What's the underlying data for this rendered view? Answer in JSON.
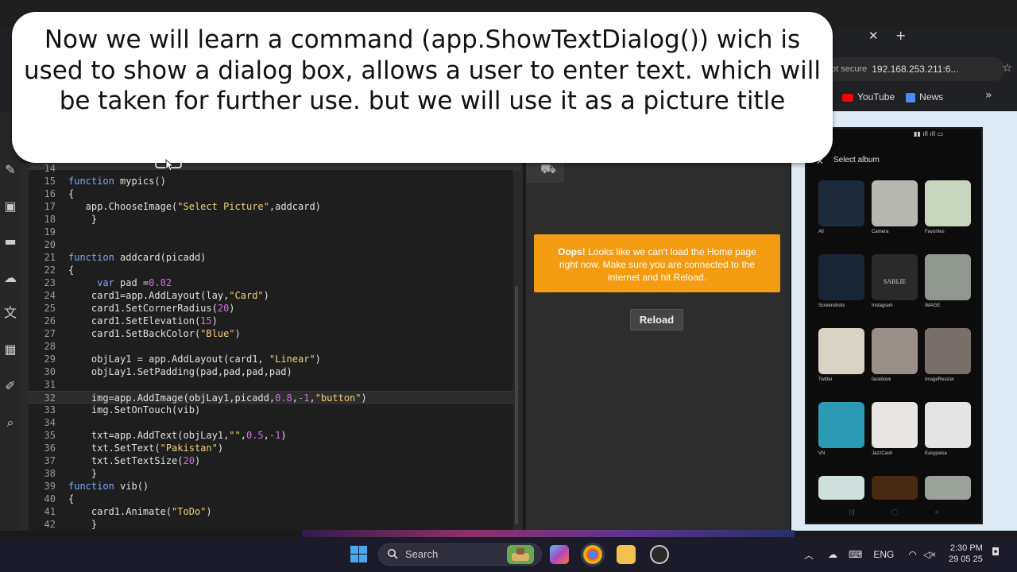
{
  "caption": "Now we will learn a command (app.ShowTextDialog()) wich is used to show a dialog box, allows a user to enter text. which will be taken for further use. but we will use it as a picture title",
  "browser": {
    "address_prefix": "ot secure",
    "address_url": "192.168.253.211:6...",
    "bookmarks": [
      "YouTube",
      "News"
    ],
    "tab_close_glyph": "✕",
    "tab_new_glyph": "+",
    "more_glyph": "»"
  },
  "editor": {
    "lines": [
      {
        "n": "14",
        "code": ""
      },
      {
        "n": "15",
        "code": "function mypics()"
      },
      {
        "n": "16",
        "code": "{"
      },
      {
        "n": "17",
        "code": "   app.ChooseImage(\"Select Picture\",addcard)"
      },
      {
        "n": "18",
        "code": "    }"
      },
      {
        "n": "19",
        "code": ""
      },
      {
        "n": "20",
        "code": ""
      },
      {
        "n": "21",
        "code": "function addcard(picadd)"
      },
      {
        "n": "22",
        "code": "{"
      },
      {
        "n": "23",
        "code": "     var pad =0.02"
      },
      {
        "n": "24",
        "code": "    card1=app.AddLayout(lay,\"Card\")"
      },
      {
        "n": "25",
        "code": "    card1.SetCornerRadius(20)"
      },
      {
        "n": "26",
        "code": "    card1.SetElevation(15)"
      },
      {
        "n": "27",
        "code": "    card1.SetBackColor(\"Blue\")"
      },
      {
        "n": "28",
        "code": ""
      },
      {
        "n": "29",
        "code": "    objLay1 = app.AddLayout(card1, \"Linear\")"
      },
      {
        "n": "30",
        "code": "    objLay1.SetPadding(pad,pad,pad,pad)"
      },
      {
        "n": "31",
        "code": ""
      },
      {
        "n": "32",
        "code": "    img=app.AddImage(objLay1,picadd,0.8,-1,\"button\")"
      },
      {
        "n": "33",
        "code": "    img.SetOnTouch(vib)"
      },
      {
        "n": "34",
        "code": ""
      },
      {
        "n": "35",
        "code": "    txt=app.AddText(objLay1,\"\",0.5,-1)"
      },
      {
        "n": "36",
        "code": "    txt.SetText(\"Pakistan\")"
      },
      {
        "n": "37",
        "code": "    txt.SetTextSize(20)"
      },
      {
        "n": "38",
        "code": "    }"
      },
      {
        "n": "39",
        "code": "function vib()"
      },
      {
        "n": "40",
        "code": "{"
      },
      {
        "n": "41",
        "code": "    card1.Animate(\"ToDo\")"
      },
      {
        "n": "42",
        "code": "    }"
      }
    ],
    "highlighted_line": "32"
  },
  "preview": {
    "oops_bold": "Oops!",
    "oops_text": "Looks like we can't load the Home page right now. Make sure you are connected to the internet and hit Reload.",
    "reload_label": "Reload"
  },
  "phone": {
    "header": "Select album",
    "albums": [
      {
        "label": "All",
        "color": "#1c2a3a"
      },
      {
        "label": "Camera",
        "color": "#b7b9b0"
      },
      {
        "label": "Favorites",
        "color": "#c8d6c0"
      },
      {
        "label": "Screenshots",
        "color": "#1a2535"
      },
      {
        "label": "Instagram",
        "color": "#2a2a2a"
      },
      {
        "label": "IMAGE",
        "color": "#8f978f"
      },
      {
        "label": "Twitter",
        "color": "#d8d2c4"
      },
      {
        "label": "facebook",
        "color": "#9a8f88"
      },
      {
        "label": "ImageResizer",
        "color": "#7a6e6a"
      },
      {
        "label": "VN",
        "color": "#2a9ab5"
      },
      {
        "label": "JazzCash",
        "color": "#e9e5e2"
      },
      {
        "label": "Easypaisa",
        "color": "#e4e4e4"
      },
      {
        "label": "",
        "color": "#cfe0dc"
      },
      {
        "label": "",
        "color": "#4a2a10"
      },
      {
        "label": "",
        "color": "#9aa29a"
      }
    ],
    "instagram_text": "SARLIE"
  },
  "taskbar": {
    "search_label": "Search",
    "language": "ENG",
    "time": "2:30 PM",
    "date": "29 05 25"
  },
  "colors": {
    "oops_bg": "#f39c12",
    "keyword": "#7fa8ff",
    "string": "#f0d07a",
    "number": "#d070e0"
  }
}
